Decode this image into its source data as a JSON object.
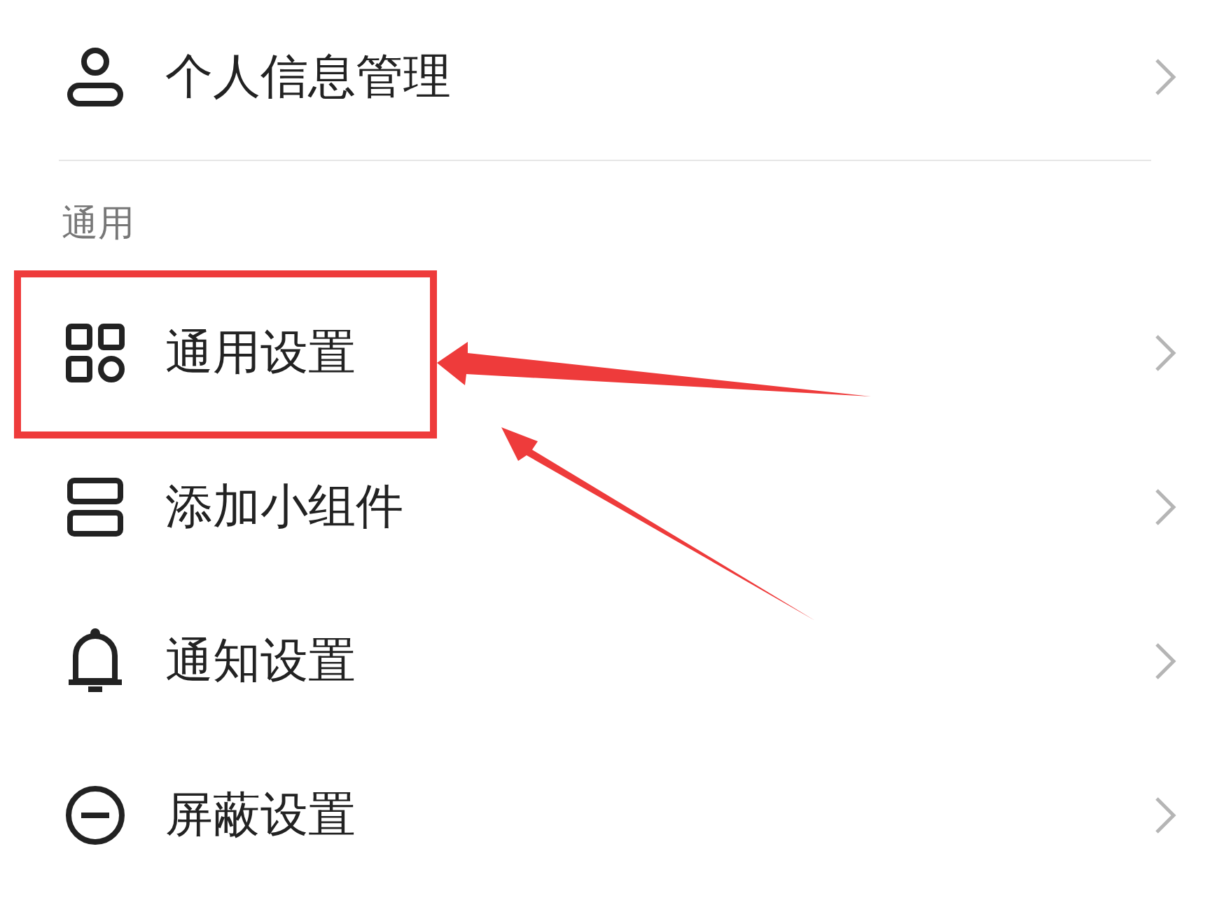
{
  "sections": [
    {
      "items": [
        {
          "label": "个人信息管理",
          "highlighted": false
        }
      ]
    },
    {
      "title": "通用",
      "items": [
        {
          "label": "通用设置",
          "highlighted": true
        },
        {
          "label": "添加小组件",
          "highlighted": false
        },
        {
          "label": "通知设置",
          "highlighted": false
        },
        {
          "label": "屏蔽设置",
          "highlighted": false
        }
      ]
    }
  ]
}
